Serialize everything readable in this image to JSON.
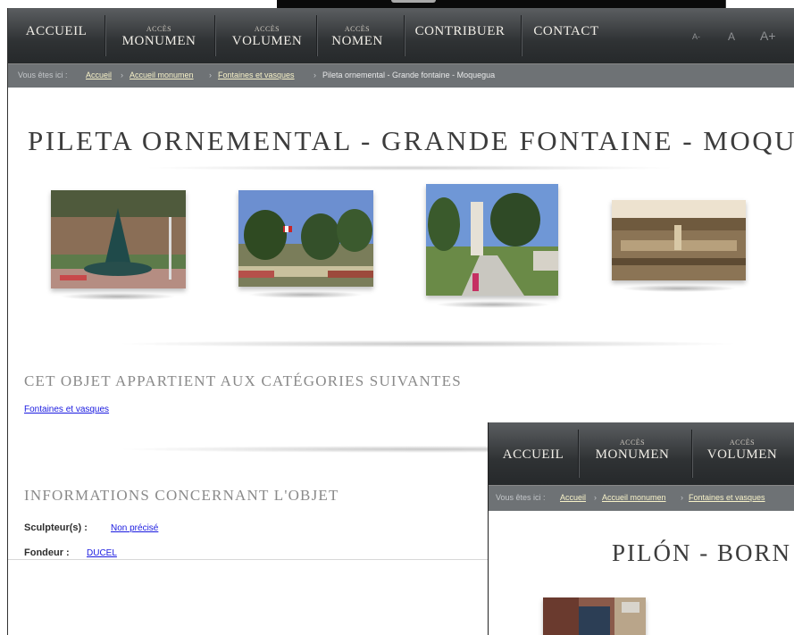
{
  "nav": {
    "items": [
      {
        "prefix": "",
        "label": "Accueil"
      },
      {
        "prefix": "Accès",
        "label": "Monumen"
      },
      {
        "prefix": "Accès",
        "label": "Volumen"
      },
      {
        "prefix": "Accès",
        "label": "Nomen"
      },
      {
        "prefix": "",
        "label": "Contribuer"
      },
      {
        "prefix": "",
        "label": "Contact"
      }
    ],
    "font_controls": [
      "A-",
      "A",
      "A+"
    ]
  },
  "breadcrumb": {
    "label": "Vous êtes ici :",
    "separator": "›",
    "links": [
      "Accueil",
      "Accueil monumen",
      "Fontaines et vasques"
    ],
    "current": "Pileta ornemental - Grande fontaine - Moquegua"
  },
  "page_title": "Pileta ornemental - Grande fontaine - Moquegua",
  "photos": [
    {
      "name": "photo-fountain-closeup",
      "sky": "#7a6a58",
      "ground": "#6d7d52"
    },
    {
      "name": "photo-plaza-flag",
      "sky": "#5f88c9",
      "ground": "#b9b38f"
    },
    {
      "name": "photo-plaza-people",
      "sky": "#6c95d3",
      "ground": "#6f8f4b"
    },
    {
      "name": "photo-sepia-old",
      "sky": "#a58f6b",
      "ground": "#8c7656"
    }
  ],
  "categories": {
    "heading": "Cet objet appartient aux catégories suivantes",
    "link": "Fontaines et vasques"
  },
  "info": {
    "heading": "Informations concernant l'objet",
    "sculptor_label": "Sculpteur(s) :",
    "sculptor_value": "Non précisé",
    "founder_label": "Fondeur :",
    "founder_value": "DUCEL"
  },
  "overlay": {
    "nav": [
      {
        "prefix": "",
        "label": "Accueil"
      },
      {
        "prefix": "Accès",
        "label": "Monumen"
      },
      {
        "prefix": "Accès",
        "label": "Volumen"
      }
    ],
    "breadcrumb_label": "Vous êtes ici :",
    "breadcrumb_links": [
      "Accueil",
      "Accueil monumen",
      "Fontaines et vasques"
    ],
    "title": "Pilón - born"
  }
}
